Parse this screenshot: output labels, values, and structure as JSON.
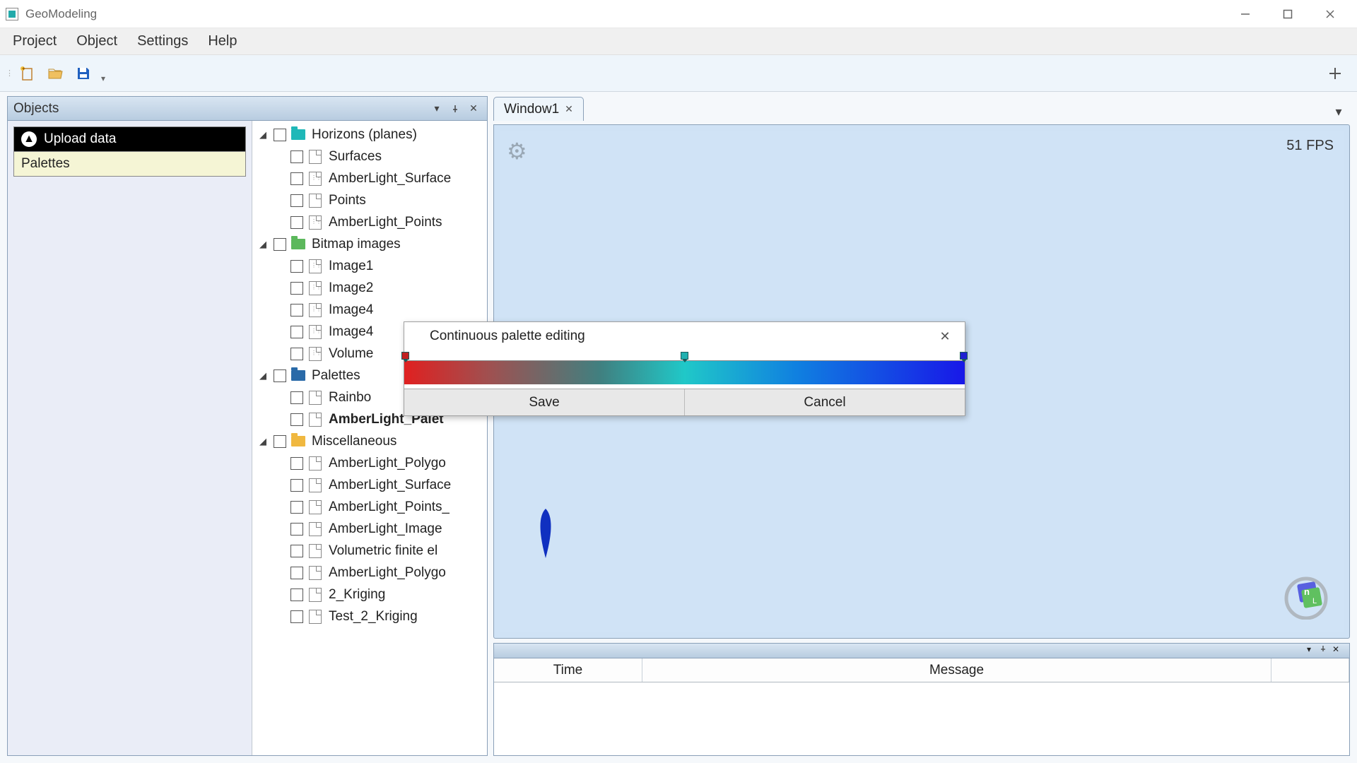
{
  "window": {
    "title": "GeoModeling"
  },
  "menu": {
    "items": [
      "Project",
      "Object",
      "Settings",
      "Help"
    ]
  },
  "sidebar": {
    "upload_label": "Upload data",
    "palettes_label": "Palettes"
  },
  "objects_panel": {
    "title": "Objects"
  },
  "tree": {
    "groups": [
      {
        "label": "Horizons (planes)",
        "folder_color": "teal",
        "children": [
          {
            "label": "Surfaces",
            "icon": "file"
          },
          {
            "label": "AmberLight_Surface",
            "icon": "dots"
          },
          {
            "label": "Points",
            "icon": "file"
          },
          {
            "label": "AmberLight_Points",
            "icon": "dots"
          }
        ]
      },
      {
        "label": "Bitmap images",
        "folder_color": "green",
        "children": [
          {
            "label": "Image1",
            "icon": "dots"
          },
          {
            "label": "Image2",
            "icon": "dots"
          },
          {
            "label": "Image4",
            "icon": "dots"
          },
          {
            "label": "Image4",
            "icon": "dots"
          },
          {
            "label": "Volume",
            "icon": "dots"
          }
        ]
      },
      {
        "label": "Palettes",
        "folder_color": "blue",
        "children": [
          {
            "label": "Rainbo",
            "icon": "file"
          },
          {
            "label": "AmberLight_Palet",
            "icon": "file",
            "bold": true
          }
        ]
      },
      {
        "label": "Miscellaneous",
        "folder_color": "yellow",
        "children": [
          {
            "label": "AmberLight_Polygo",
            "icon": "file"
          },
          {
            "label": "AmberLight_Surface",
            "icon": "file"
          },
          {
            "label": "AmberLight_Points_",
            "icon": "file"
          },
          {
            "label": "AmberLight_Image",
            "icon": "file"
          },
          {
            "label": "Volumetric finite el",
            "icon": "file"
          },
          {
            "label": "AmberLight_Polygo",
            "icon": "file"
          },
          {
            "label": "2_Kriging",
            "icon": "file"
          },
          {
            "label": "Test_2_Kriging",
            "icon": "file"
          }
        ]
      }
    ]
  },
  "viewport": {
    "tab_label": "Window1",
    "fps": "51 FPS"
  },
  "log": {
    "columns": {
      "time": "Time",
      "message": "Message"
    }
  },
  "dialog": {
    "title": "Continuous palette editing",
    "save": "Save",
    "cancel": "Cancel",
    "gradient_stops": [
      {
        "pos": 0.0,
        "color": "#e02020"
      },
      {
        "pos": 0.5,
        "color": "#20b0b0"
      },
      {
        "pos": 1.0,
        "color": "#1818e8"
      }
    ]
  }
}
